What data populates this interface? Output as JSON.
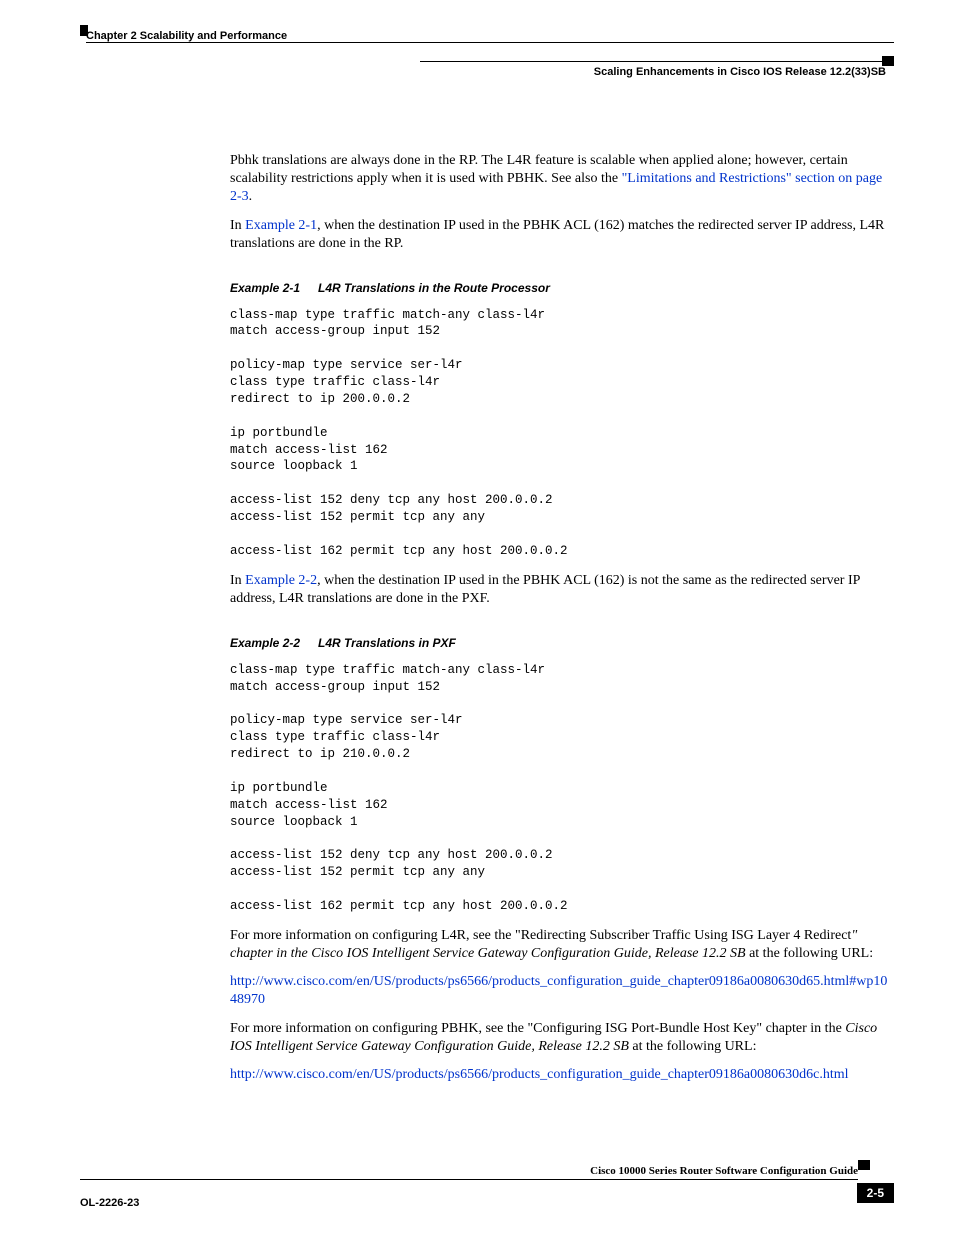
{
  "header": {
    "chapter": "Chapter 2      Scalability and Performance",
    "section": "Scaling Enhancements in Cisco IOS Release 12.2(33)SB"
  },
  "para1_a": "Pbhk translations are always done in the RP. The L4R feature is scalable when applied alone; however, certain scalability restrictions apply when it is used with PBHK. See also the ",
  "para1_link": "\"Limitations and Restrictions\" section on page 2-3",
  "para1_b": ".",
  "para2_a": "In ",
  "para2_link": "Example 2-1",
  "para2_b": ", when the destination IP used in the PBHK ACL (162) matches the redirected server IP address, L4R translations are done in the RP.",
  "example1": {
    "label": "Example 2-1",
    "title": "L4R Translations in the Route Processor",
    "code": "class-map type traffic match-any class-l4r\nmatch access-group input 152\n\npolicy-map type service ser-l4r\nclass type traffic class-l4r\nredirect to ip 200.0.0.2\n\nip portbundle\nmatch access-list 162\nsource loopback 1\n\naccess-list 152 deny tcp any host 200.0.0.2\naccess-list 152 permit tcp any any\n\naccess-list 162 permit tcp any host 200.0.0.2"
  },
  "para3_a": "In ",
  "para3_link": "Example 2-2",
  "para3_b": ", when the destination IP used in the PBHK ACL (162) is not the same as the redirected server IP address, L4R translations are done in the PXF.",
  "example2": {
    "label": "Example 2-2",
    "title": "L4R Translations in PXF",
    "code": "class-map type traffic match-any class-l4r\nmatch access-group input 152\n\npolicy-map type service ser-l4r\nclass type traffic class-l4r\nredirect to ip 210.0.0.2\n\nip portbundle\nmatch access-list 162\nsource loopback 1\n\naccess-list 152 deny tcp any host 200.0.0.2\naccess-list 152 permit tcp any any\n\naccess-list 162 permit tcp any host 200.0.0.2"
  },
  "para4_a": "For more information on configuring L4R, see the \"Redirecting Subscriber Traffic Using ISG Layer 4 Redirect",
  "para4_b": "\" chapter in the ",
  "para4_c": "Cisco IOS Intelligent Service Gateway Configuration Guide, Release 12.2 SB",
  "para4_d": " at the following URL:",
  "url1": "http://www.cisco.com/en/US/products/ps6566/products_configuration_guide_chapter09186a0080630d65.html#wp1048970",
  "para5_a": "For more information on configuring PBHK, see the \"Configuring ISG Port-Bundle Host Key\" chapter in the ",
  "para5_b": "Cisco IOS Intelligent Service Gateway Configuration Guide, Release 12.2 SB",
  "para5_c": " at the following URL:",
  "url2": "http://www.cisco.com/en/US/products/ps6566/products_configuration_guide_chapter09186a0080630d6c.html",
  "footer": {
    "guide": "Cisco 10000 Series Router Software Configuration Guide",
    "docnum": "OL-2226-23",
    "pagenum": "2-5"
  }
}
